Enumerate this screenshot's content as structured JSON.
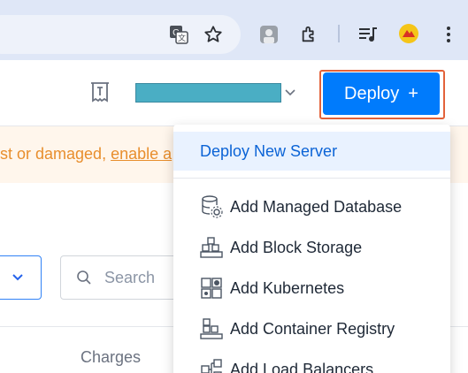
{
  "colors": {
    "accent": "#007bfc",
    "notice_text": "#e88e2d",
    "highlight_outline": "#e3623a",
    "team_select": "#4aaec4"
  },
  "browser": {
    "icons": [
      "translate-icon",
      "bookmark-star-icon",
      "profile-icon",
      "extensions-icon",
      "media-queue-icon",
      "avatar-extension-icon",
      "kebab-menu-icon"
    ]
  },
  "header": {
    "deploy_label": "Deploy",
    "deploy_plus": "+"
  },
  "notice": {
    "text_prefix": "st or damaged, ",
    "link_text": "enable a"
  },
  "search": {
    "placeholder": "Search"
  },
  "table": {
    "charges_header": "Charges"
  },
  "deploy_menu": {
    "primary": "Deploy New Server",
    "items": [
      {
        "label": "Add Managed Database",
        "icon": "database-gear-icon"
      },
      {
        "label": "Add Block Storage",
        "icon": "block-storage-icon"
      },
      {
        "label": "Add Kubernetes",
        "icon": "kubernetes-icon"
      },
      {
        "label": "Add Container Registry",
        "icon": "container-registry-icon"
      },
      {
        "label": "Add Load Balancers",
        "icon": "load-balancer-icon"
      }
    ]
  }
}
